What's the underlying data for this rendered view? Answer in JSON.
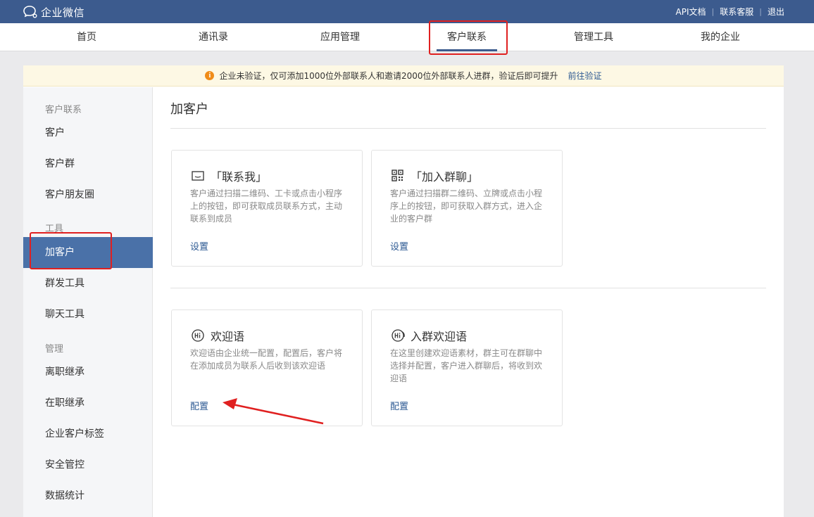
{
  "topbar": {
    "app_name": "企业微信",
    "links": [
      "API文档",
      "联系客服",
      "退出"
    ]
  },
  "nav": {
    "items": [
      "首页",
      "通讯录",
      "应用管理",
      "客户联系",
      "管理工具",
      "我的企业"
    ],
    "active": "客户联系"
  },
  "notice": {
    "text": "企业未验证，仅可添加1000位外部联系人和邀请2000位外部联系人进群，验证后即可提升",
    "link": "前往验证"
  },
  "sidebar": {
    "group_customer": "客户联系",
    "customer": "客户",
    "customer_group": "客户群",
    "moments": "客户朋友圈",
    "group_tools": "工具",
    "add_customer": "加客户",
    "mass_send": "群发工具",
    "chat_tools": "聊天工具",
    "group_manage": "管理",
    "resign_inherit": "离职继承",
    "onjob_inherit": "在职继承",
    "tags": "企业客户标签",
    "security": "安全管控",
    "statistics": "数据统计"
  },
  "main": {
    "title": "加客户",
    "cards": {
      "contact_me": {
        "title": "「联系我」",
        "desc": "客户通过扫描二维码、工卡或点击小程序上的按钮，即可获取成员联系方式，主动联系到成员",
        "link": "设置"
      },
      "join_group": {
        "title": "「加入群聊」",
        "desc": "客户通过扫描群二维码、立牌或点击小程序上的按钮，即可获取入群方式，进入企业的客户群",
        "link": "设置"
      },
      "welcome": {
        "title": "欢迎语",
        "desc": "欢迎语由企业统一配置，配置后，客户将在添加成员为联系人后收到该欢迎语",
        "link": "配置"
      },
      "group_welcome": {
        "title": "入群欢迎语",
        "desc": "在这里创建欢迎语素材，群主可在群聊中选择并配置，客户进入群聊后，将收到欢迎语",
        "link": "配置"
      }
    }
  },
  "colors": {
    "topbar": "#3c5b8e",
    "active_sidebar": "#4a71a8",
    "link": "#2d5a93",
    "highlight": "#e02020"
  }
}
